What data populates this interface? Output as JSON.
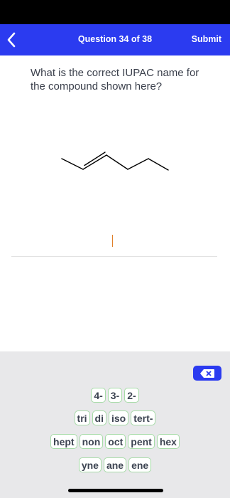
{
  "header": {
    "title": "Question 34 of 38",
    "submit_label": "Submit"
  },
  "question": {
    "text": "What is the correct IUPAC name for the compound shown here?"
  },
  "keyboard": {
    "rows": [
      [
        "4-",
        "3-",
        "2-"
      ],
      [
        "tri",
        "di",
        "iso",
        "tert-"
      ],
      [
        "hept",
        "non",
        "oct",
        "pent",
        "hex"
      ],
      [
        "yne",
        "ane",
        "ene"
      ]
    ],
    "backspace_icon": "backspace-icon"
  },
  "colors": {
    "accent": "#2b3bf0",
    "key_border": "#a6dba7",
    "keyboard_bg": "#e8e8ea",
    "caret": "#e0802a"
  }
}
